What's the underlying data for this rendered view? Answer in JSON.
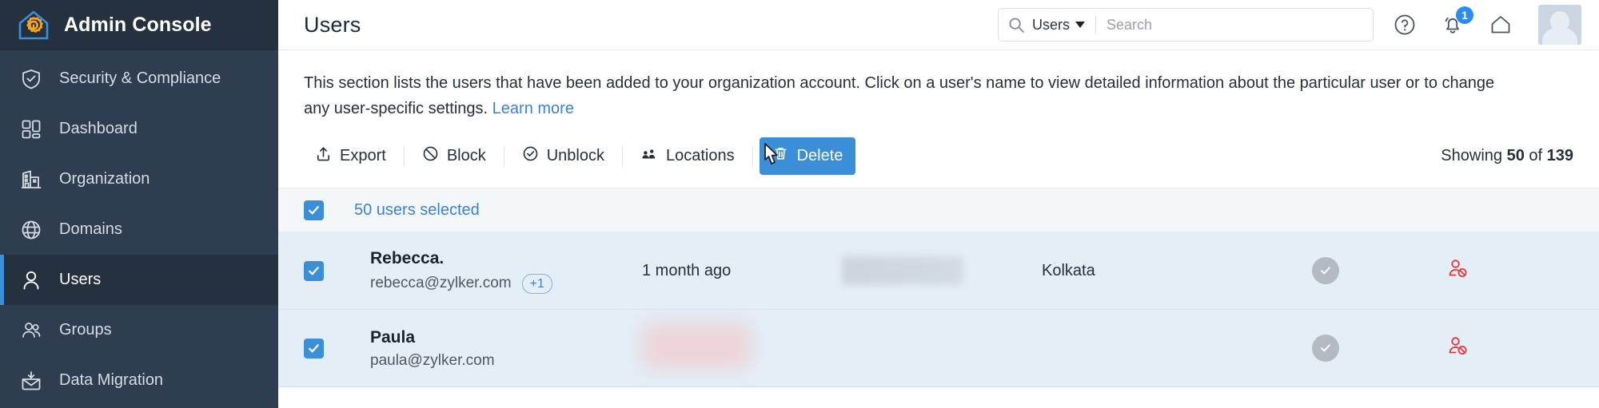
{
  "brand": {
    "title": "Admin Console",
    "logo_icon": "house-gear-logo",
    "colors": {
      "house": "#3b8ed8",
      "gear": "#f5a623"
    }
  },
  "sidebar": {
    "items": [
      {
        "label": "Security & Compliance",
        "icon": "shield-check-icon",
        "active": false
      },
      {
        "label": "Dashboard",
        "icon": "dashboard-grid-icon",
        "active": false
      },
      {
        "label": "Organization",
        "icon": "building-icon",
        "active": false
      },
      {
        "label": "Domains",
        "icon": "globe-icon",
        "active": false
      },
      {
        "label": "Users",
        "icon": "user-icon",
        "active": true
      },
      {
        "label": "Groups",
        "icon": "users-group-icon",
        "active": false
      },
      {
        "label": "Data Migration",
        "icon": "migration-envelope-icon",
        "active": false
      }
    ]
  },
  "header": {
    "title": "Users",
    "search": {
      "scope": "Users",
      "scope_icon": "search-icon",
      "caret_icon": "chevron-down-icon",
      "placeholder": "Search",
      "value": ""
    },
    "help_icon": "help-circle-icon",
    "notifications_icon": "bell-icon",
    "notifications_count": "1",
    "home_icon": "home-icon",
    "avatar_icon": "user-avatar"
  },
  "description": {
    "text": "This section lists the users that have been added to your organization account. Click on a user's name to view detailed information about the particular user or to change any user-specific settings.",
    "link": "Learn more"
  },
  "toolbar": {
    "buttons": [
      {
        "label": "Export",
        "icon": "upload-export-icon",
        "primary": false
      },
      {
        "label": "Block",
        "icon": "block-circle-icon",
        "primary": false
      },
      {
        "label": "Unblock",
        "icon": "check-circle-icon",
        "primary": false
      },
      {
        "label": "Locations",
        "icon": "locations-icon",
        "primary": false
      },
      {
        "label": "Delete",
        "icon": "trash-icon",
        "primary": true
      }
    ],
    "showing_prefix": "Showing ",
    "showing_count": "50",
    "showing_mid": " of ",
    "showing_total": "139"
  },
  "selection": {
    "label": "50 users selected",
    "checked": true
  },
  "table": {
    "rows": [
      {
        "checked": true,
        "name": "Rebecca.",
        "email": "rebecca@zylker.com",
        "extra_pill": "+1",
        "last_active": "1 month ago",
        "redacted": "gray",
        "location": "Kolkata",
        "status_icon": "check-circle-filled-icon",
        "action_icon": "block-user-icon"
      },
      {
        "checked": true,
        "name": "Paula",
        "email": "paula@zylker.com",
        "extra_pill": "",
        "last_active": "",
        "redacted": "pink",
        "location": "",
        "status_icon": "check-circle-filled-icon",
        "action_icon": "block-user-icon"
      }
    ]
  },
  "colors": {
    "sidebar_bg": "#2f3d50",
    "sidebar_active_bg": "#26313f",
    "accent": "#3b8ed8",
    "link": "#3b82d6",
    "row_selected_bg": "#e3eef7",
    "danger": "#f0333a"
  }
}
